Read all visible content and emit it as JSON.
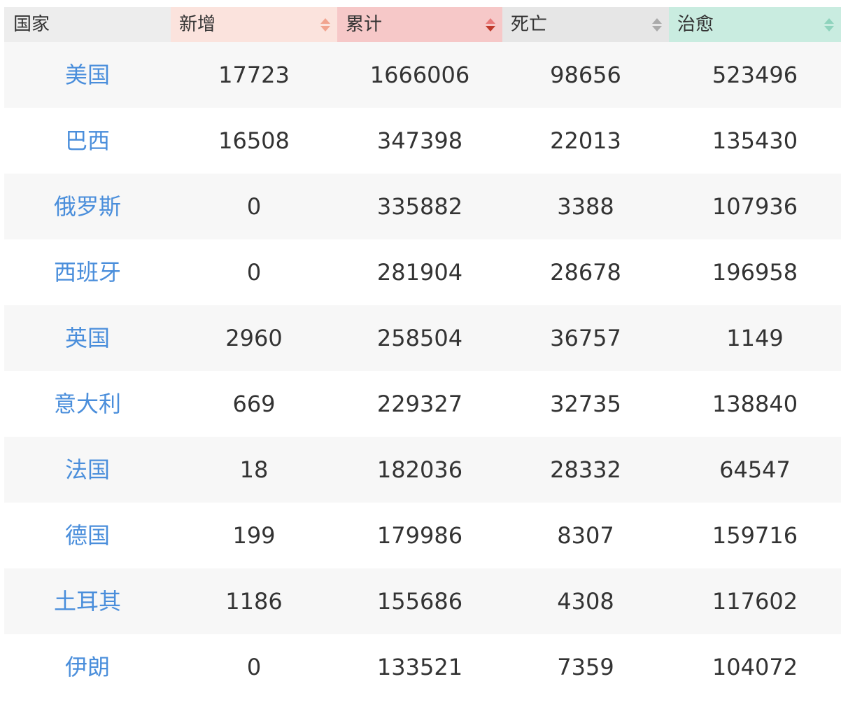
{
  "table": {
    "headers": {
      "country": "国家",
      "new": "新增",
      "total": "累计",
      "dead": "死亡",
      "cured": "治愈"
    },
    "rows": [
      {
        "country": "美国",
        "new": "17723",
        "total": "1666006",
        "dead": "98656",
        "cured": "523496"
      },
      {
        "country": "巴西",
        "new": "16508",
        "total": "347398",
        "dead": "22013",
        "cured": "135430"
      },
      {
        "country": "俄罗斯",
        "new": "0",
        "total": "335882",
        "dead": "3388",
        "cured": "107936"
      },
      {
        "country": "西班牙",
        "new": "0",
        "total": "281904",
        "dead": "28678",
        "cured": "196958"
      },
      {
        "country": "英国",
        "new": "2960",
        "total": "258504",
        "dead": "36757",
        "cured": "1149"
      },
      {
        "country": "意大利",
        "new": "669",
        "total": "229327",
        "dead": "32735",
        "cured": "138840"
      },
      {
        "country": "法国",
        "new": "18",
        "total": "182036",
        "dead": "28332",
        "cured": "64547"
      },
      {
        "country": "德国",
        "new": "199",
        "total": "179986",
        "dead": "8307",
        "cured": "159716"
      },
      {
        "country": "土耳其",
        "new": "1186",
        "total": "155686",
        "dead": "4308",
        "cured": "117602"
      },
      {
        "country": "伊朗",
        "new": "0",
        "total": "133521",
        "dead": "7359",
        "cured": "104072"
      }
    ]
  },
  "colors": {
    "link": "#4a8edb",
    "header_new": "#fbe3dd",
    "header_total": "#f6c8c8",
    "header_dead": "#e6e6e6",
    "header_cured": "#c9ece0",
    "active_sort_arrow": "#c0392b"
  }
}
